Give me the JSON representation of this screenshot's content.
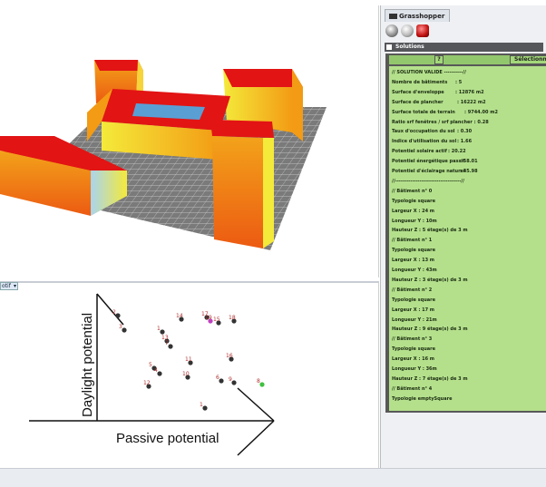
{
  "grasshopper": {
    "tab_label": "Grasshopper",
    "section_label": "Solutions",
    "question_button": "?",
    "select_button": "Sélectionner",
    "lines": [
      {
        "label": "// SOLUTION VALIDE ----------//",
        "value": ""
      },
      {
        "label": "Nombre de bâtiments",
        "value": ": 5"
      },
      {
        "label": "Surface d'enveloppe",
        "value": ": 12876 m2"
      },
      {
        "label": "Surface de plancher",
        "value": ": 16222 m2"
      },
      {
        "label": "Surface totale de terrain",
        "value": ": 9744.00 m2"
      },
      {
        "label": "Ratio srf fenêtres / srf plancher : 0.28",
        "value": ""
      },
      {
        "label": "Taux d'occupation du sol",
        "value": ": 0.30"
      },
      {
        "label": "Indice d'utilisation du sol",
        "value": ": 1.66"
      },
      {
        "label": "Potentiel solaire actif",
        "value": ": 20.22"
      },
      {
        "label": "Potentiel énergétique passif",
        "value": ": 58.01"
      },
      {
        "label": "Potentiel d'éclairage naturel",
        "value": ": 45.98"
      },
      {
        "label": "//-----------------------------------//",
        "value": ""
      },
      {
        "label": "// Bâtiment n° 0",
        "value": ""
      },
      {
        "label": "Typologie square",
        "value": ""
      },
      {
        "label": "Largeur X : 24 m",
        "value": ""
      },
      {
        "label": "Longueur Y : 10m",
        "value": ""
      },
      {
        "label": "Hauteur Z : 5 étage(s) de 3 m",
        "value": ""
      },
      {
        "label": "// Bâtiment n° 1",
        "value": ""
      },
      {
        "label": "Typologie square",
        "value": ""
      },
      {
        "label": "Largeur X : 13 m",
        "value": ""
      },
      {
        "label": "Longueur Y : 43m",
        "value": ""
      },
      {
        "label": "Hauteur Z : 3 étage(s) de 3 m",
        "value": ""
      },
      {
        "label": "// Bâtiment n° 2",
        "value": ""
      },
      {
        "label": "Typologie square",
        "value": ""
      },
      {
        "label": "Largeur X : 17 m",
        "value": ""
      },
      {
        "label": "Longueur Y : 21m",
        "value": ""
      },
      {
        "label": "Hauteur Z : 9 étage(s) de 3 m",
        "value": ""
      },
      {
        "label": "// Bâtiment n° 3",
        "value": ""
      },
      {
        "label": "Typologie square",
        "value": ""
      },
      {
        "label": "Largeur X : 16 m",
        "value": ""
      },
      {
        "label": "Longueur Y : 36m",
        "value": ""
      },
      {
        "label": "Hauteur Z : 7 étage(s) de 3 m",
        "value": ""
      },
      {
        "label": "// Bâtiment n° 4",
        "value": ""
      },
      {
        "label": "Typologie emptySquare",
        "value": ""
      }
    ]
  },
  "scatter": {
    "dropdown_label": "otif",
    "x_axis_label": "Passive potential",
    "y_axis_label": "Daylight potential",
    "points": [
      {
        "label": "2"
      },
      {
        "label": "3"
      },
      {
        "label": "14"
      },
      {
        "label": "17"
      },
      {
        "label": "15"
      },
      {
        "label": "18"
      },
      {
        "label": "1"
      },
      {
        "label": "13"
      },
      {
        "label": "7"
      },
      {
        "label": "11"
      },
      {
        "label": "16"
      },
      {
        "label": "5"
      },
      {
        "label": "4"
      },
      {
        "label": "10"
      },
      {
        "label": "6"
      },
      {
        "label": "12"
      },
      {
        "label": "9"
      },
      {
        "label": "1"
      },
      {
        "label": "8"
      },
      {
        "label": "19"
      }
    ]
  },
  "icons": [
    "grasshopper-logo-icon",
    "sphere-tool-icon",
    "sketch-tool-icon",
    "red-gem-icon",
    "section-toggle-icon",
    "dropdown-arrow-icon"
  ],
  "colors": {
    "panel_green": "#b4e08c",
    "building_roof": "#e21414",
    "building_side_orange": "#f39b14",
    "building_side_yellow": "#f4ea3a",
    "grid_gray": "#6b6b6b",
    "highlight_magenta": "#c040c0",
    "highlight_green": "#40c040"
  }
}
